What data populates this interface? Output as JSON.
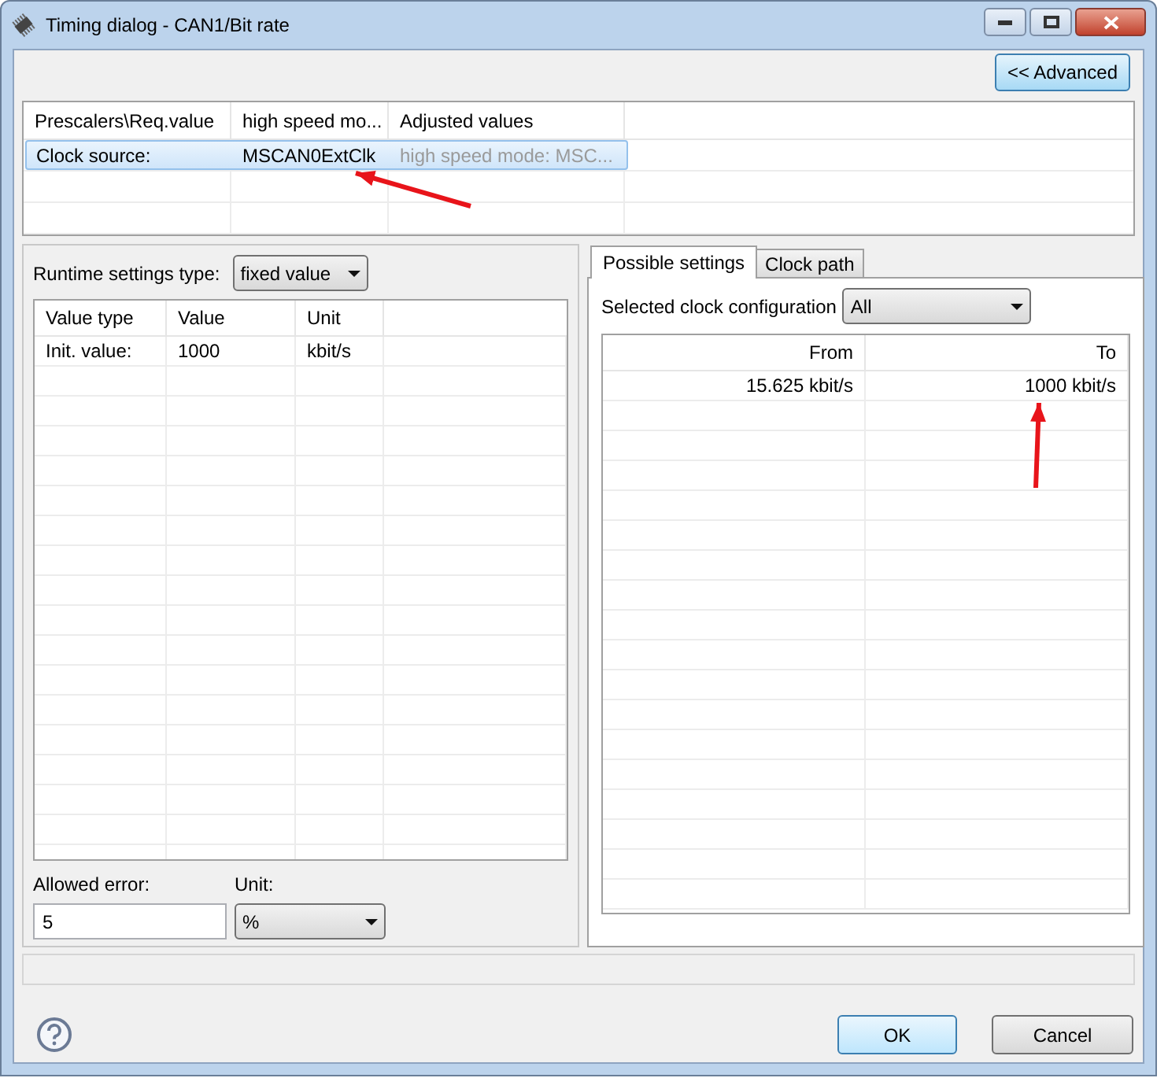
{
  "window": {
    "title": "Timing dialog - CAN1/Bit rate"
  },
  "advanced_button": {
    "label": "<< Advanced"
  },
  "prescaler_table": {
    "columns": [
      "Prescalers\\Req.value",
      "high speed mo...",
      "Adjusted values"
    ],
    "rows": [
      {
        "selected": true,
        "cells": [
          {
            "text": "Clock source:",
            "disabled": false
          },
          {
            "text": "MSCAN0ExtClk",
            "disabled": false
          },
          {
            "text": "high speed mode: MSC...",
            "disabled": true
          }
        ]
      }
    ]
  },
  "runtime_settings": {
    "label": "Runtime settings type:",
    "value": "fixed value"
  },
  "values_table": {
    "columns": [
      "Value type",
      "Value",
      "Unit"
    ],
    "rows": [
      [
        "Init. value:",
        "1000",
        "kbit/s"
      ]
    ]
  },
  "allowed_error": {
    "label": "Allowed error:",
    "value": "5"
  },
  "unit": {
    "label": "Unit:",
    "value": "%"
  },
  "tabs": [
    {
      "label": "Possible settings",
      "selected": true
    },
    {
      "label": "Clock path",
      "selected": false
    }
  ],
  "clock_configuration": {
    "label": "Selected clock configuration",
    "value": "All"
  },
  "range_table": {
    "columns": [
      "From",
      "To"
    ],
    "rows": [
      [
        "15.625 kbit/s",
        "1000 kbit/s"
      ]
    ]
  },
  "buttons": [
    {
      "label": "OK",
      "default": true
    },
    {
      "label": "Cancel",
      "default": false
    }
  ]
}
